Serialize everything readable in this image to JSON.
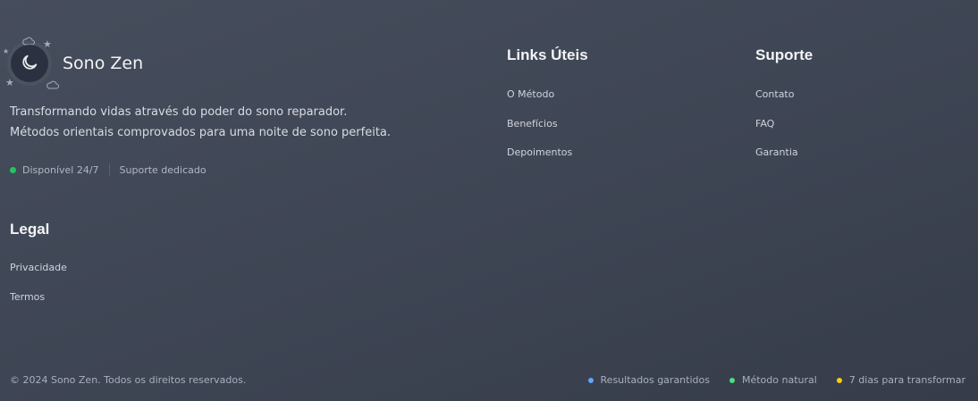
{
  "brand": {
    "name": "Sono Zen",
    "icon": "moon-icon",
    "tagline": "Transformando vidas através do poder do sono reparador. Métodos orientais comprovados para uma noite de sono perfeita."
  },
  "status": {
    "availability": "Disponível 24/7",
    "availability_color": "#22c55e",
    "support": "Suporte dedicado"
  },
  "columns": {
    "useful_links": {
      "title": "Links Úteis",
      "items": [
        "O Método",
        "Benefícios",
        "Depoimentos"
      ]
    },
    "support": {
      "title": "Suporte",
      "items": [
        "Contato",
        "FAQ",
        "Garantia"
      ]
    },
    "legal": {
      "title": "Legal",
      "items": [
        "Privacidade",
        "Termos"
      ]
    }
  },
  "footer": {
    "copyright": "© 2024 Sono Zen. Todos os direitos reservados.",
    "badges": [
      {
        "label": "Resultados garantidos",
        "color": "#60a5fa"
      },
      {
        "label": "Método natural",
        "color": "#4ade80"
      },
      {
        "label": "7 dias para transformar",
        "color": "#facc15"
      }
    ]
  }
}
